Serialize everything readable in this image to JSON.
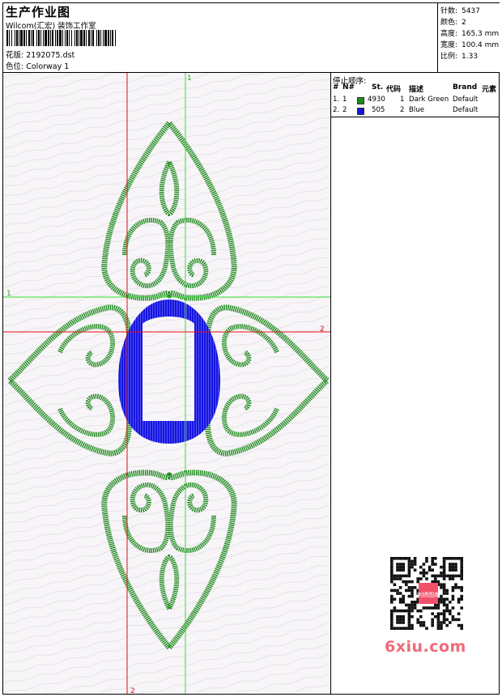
{
  "header": {
    "title": "生产作业图",
    "studio": "Wilcom(汇宏) 装饰工作室",
    "design_label": "花版:",
    "design_file": "2192075.dst",
    "colorway_label": "色位:",
    "colorway": "Colorway 1"
  },
  "stats": [
    {
      "label": "针数:",
      "value": "5437"
    },
    {
      "label": "颜色:",
      "value": "2"
    },
    {
      "label": "高度:",
      "value": "165.3 mm"
    },
    {
      "label": "宽度:",
      "value": "100.4 mm"
    },
    {
      "label": "比例:",
      "value": "1.33"
    }
  ],
  "stop_sequence": {
    "title": "停止顺序:",
    "columns": [
      "#",
      "N#",
      "St.",
      "代码",
      "描述",
      "Brand",
      "元素"
    ],
    "rows": [
      {
        "index": "1.",
        "needle": "1",
        "color": "#1f8a1f",
        "stitches": "4930",
        "code": "1",
        "description": "Dark Green",
        "brand": "Default"
      },
      {
        "index": "2.",
        "needle": "2",
        "color": "#1414e0",
        "stitches": "505",
        "code": "2",
        "description": "Blue",
        "brand": "Default"
      }
    ]
  },
  "guides": {
    "green_vertical_label": "1",
    "green_horizontal_label": "1",
    "red_vertical_label": "2",
    "red_horizontal_label": "2"
  },
  "colors": {
    "green_thread": "#1f8a1f",
    "blue_thread": "#1414e0",
    "guide_green": "#33dd33",
    "guide_red": "#e01010",
    "watermark": "#f06a7a"
  },
  "watermark": {
    "text": "6xiu.com",
    "stamp": "刺绣图库"
  }
}
